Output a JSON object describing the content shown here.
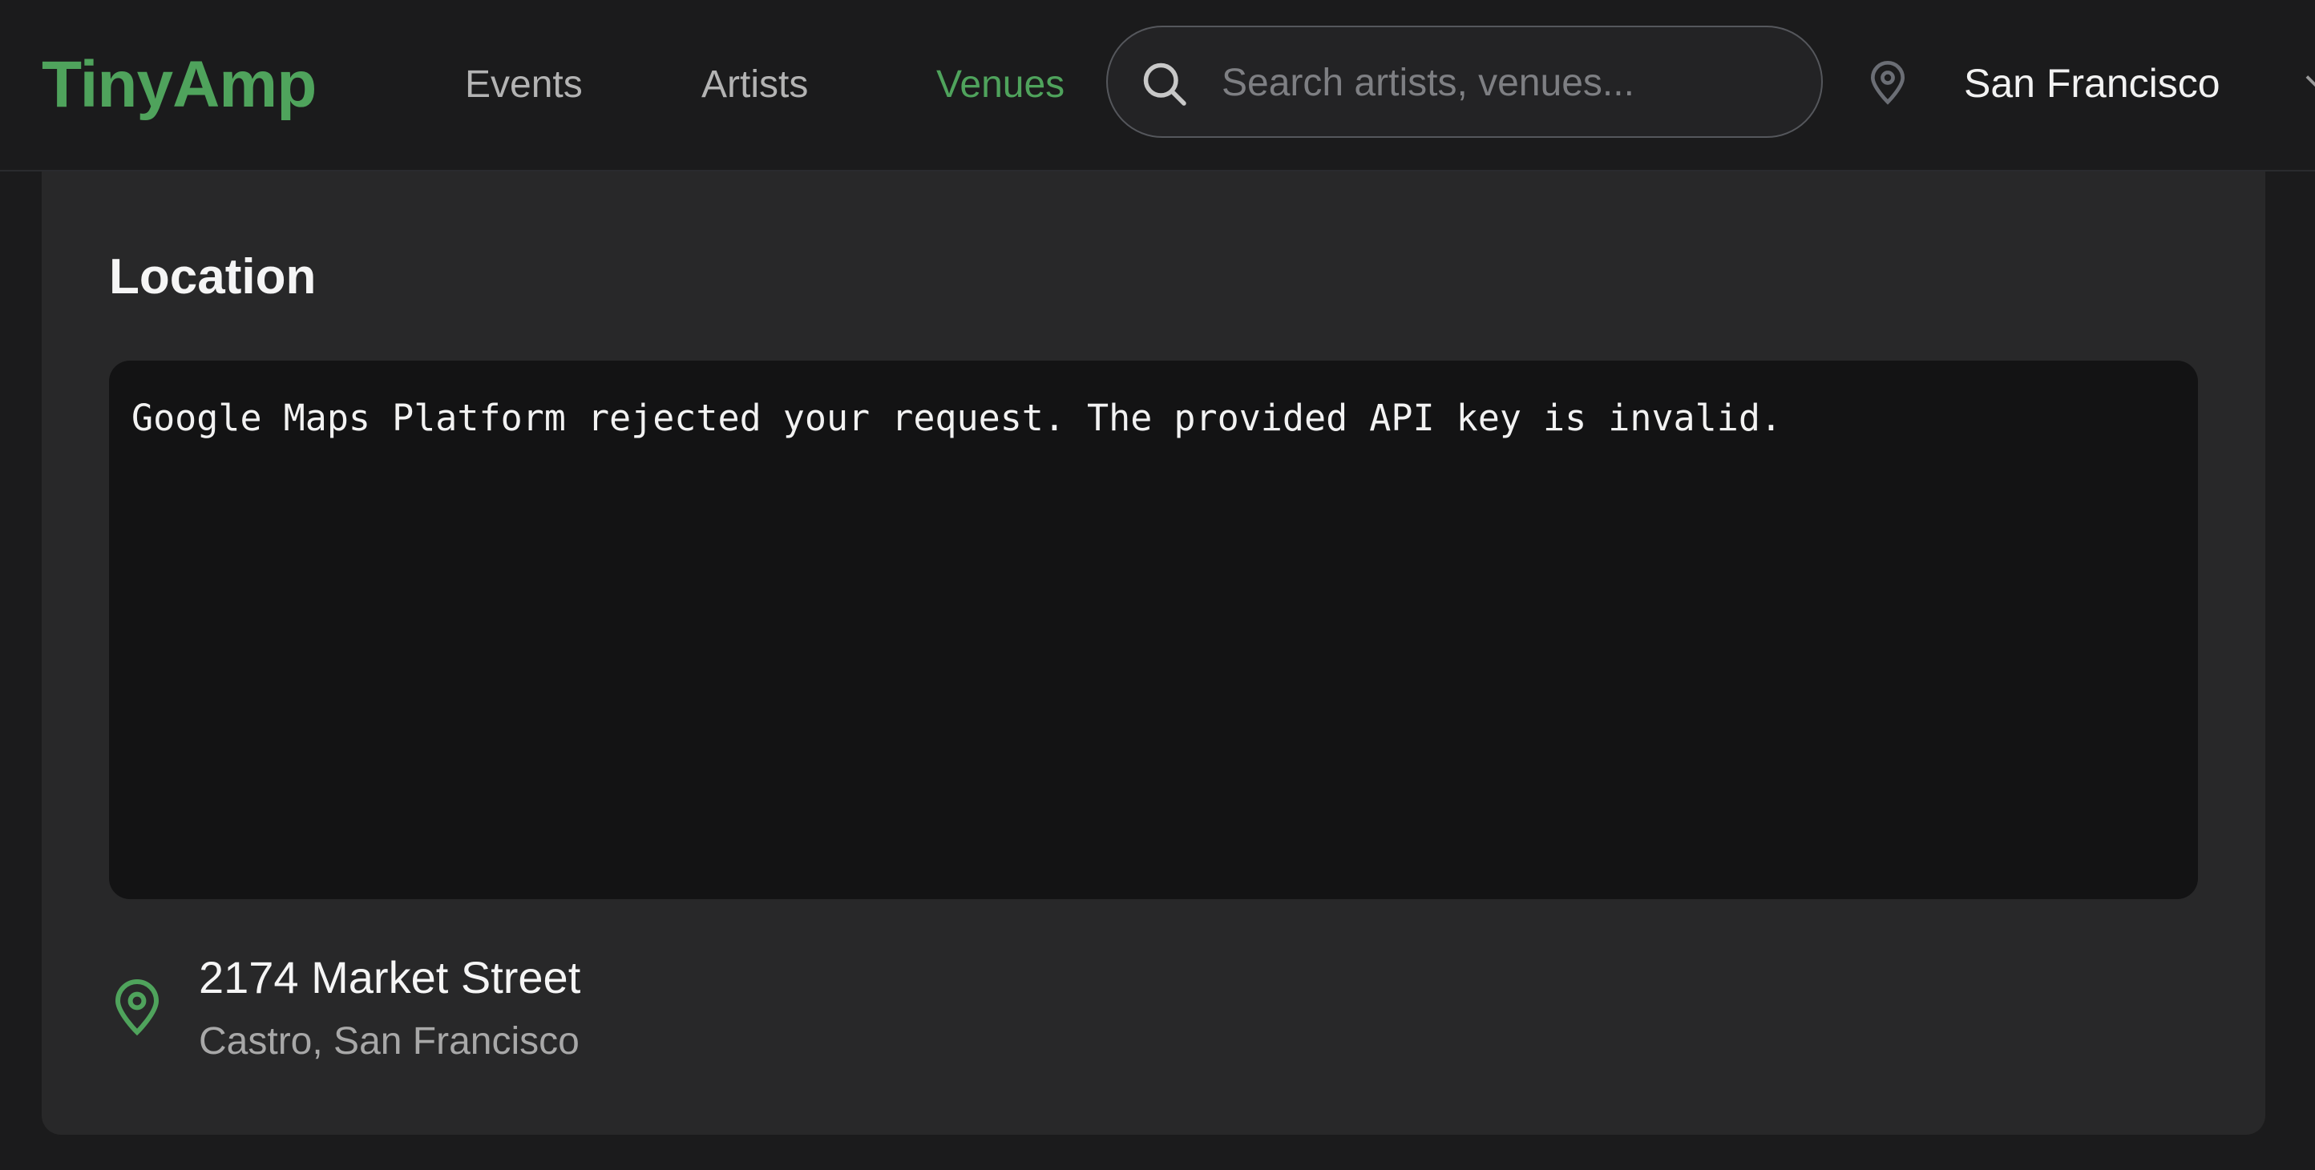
{
  "header": {
    "logo": "TinyAmp",
    "nav": [
      {
        "label": "Events",
        "active": false
      },
      {
        "label": "Artists",
        "active": false
      },
      {
        "label": "Venues",
        "active": true
      }
    ],
    "search": {
      "placeholder": "Search artists, venues...",
      "icon": "search-icon"
    },
    "location": {
      "icon": "map-pin-icon",
      "city": "San Francisco"
    }
  },
  "location_card": {
    "title": "Location",
    "map": {
      "error_message": "Google Maps Platform rejected your request. The provided API key is invalid."
    },
    "address": {
      "icon": "map-pin-icon",
      "street": "2174 Market Street",
      "area": "Castro, San Francisco"
    }
  },
  "colors": {
    "accent": "#4fa35c",
    "background": "#1b1b1c",
    "card": "#282829",
    "map_background": "#131314"
  }
}
